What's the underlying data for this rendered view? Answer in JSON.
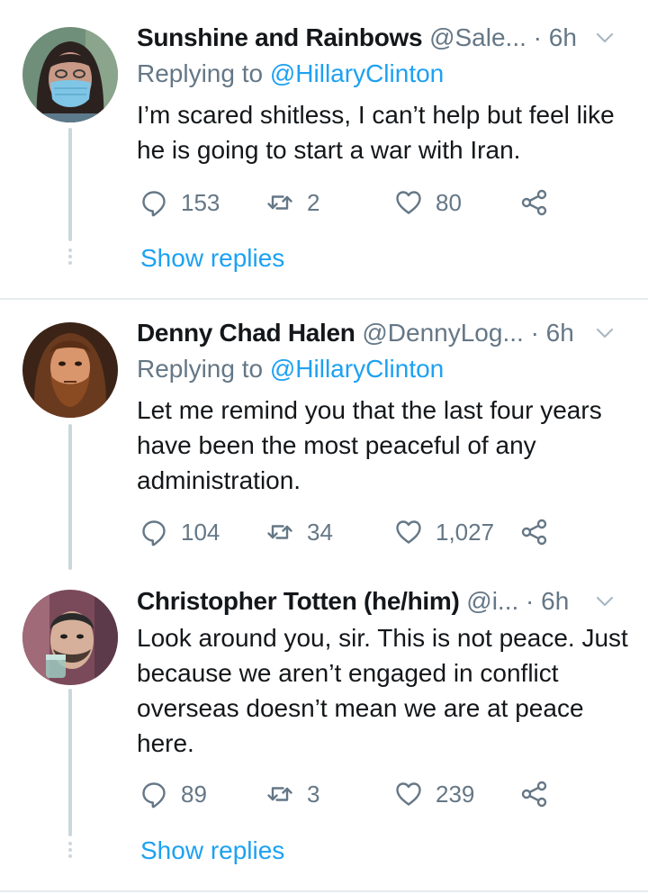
{
  "tweets": [
    {
      "name": "Sunshine and Rainbows",
      "handle": "@Sale...",
      "time": "· 6h",
      "replying_prefix": "Replying to ",
      "replying_to": "@HillaryClinton",
      "text": "I’m scared shitless, I can’t help but feel like he is going to start a war with Iran.",
      "replies": "153",
      "retweets": "2",
      "likes": "80",
      "show_replies": "Show replies",
      "avatar_colors": {
        "bg": "#6f8f7a",
        "skin": "#c99a86",
        "hair": "#2b2220",
        "mask": "#7fc6e6"
      }
    },
    {
      "name": "Denny Chad Halen",
      "handle": "@DennyLog...",
      "time": "· 6h",
      "replying_prefix": "Replying to ",
      "replying_to": "@HillaryClinton",
      "text": "Let me remind you that the last four years have been the most peaceful of any administration.",
      "replies": "104",
      "retweets": "34",
      "likes": "1,027",
      "avatar_colors": {
        "bg": "#3b2417",
        "skin": "#d9956c",
        "hair": "#6a3a1e",
        "beard": "#8a4a22"
      }
    },
    {
      "name": "Christopher Totten (he/him)",
      "handle": "@i...",
      "time": "· 6h",
      "text": "Look around you, sir. This is not peace. Just because we aren’t engaged in conflict overseas doesn’t mean we are at peace here.",
      "replies": "89",
      "retweets": "3",
      "likes": "239",
      "show_replies": "Show replies",
      "avatar_colors": {
        "bg": "#7a4a5a",
        "skin": "#d6b09a",
        "hair": "#2a2a2a",
        "glass": "#9ec9c0"
      }
    }
  ],
  "icons": {
    "reply": "reply-icon",
    "retweet": "retweet-icon",
    "like": "like-icon",
    "share": "share-icon",
    "caret": "chevron-down-icon"
  },
  "colors": {
    "accent": "#1da1f2",
    "secondary_text": "#657786",
    "thread_line": "#ccd6dd",
    "divider": "#e6ecf0"
  }
}
